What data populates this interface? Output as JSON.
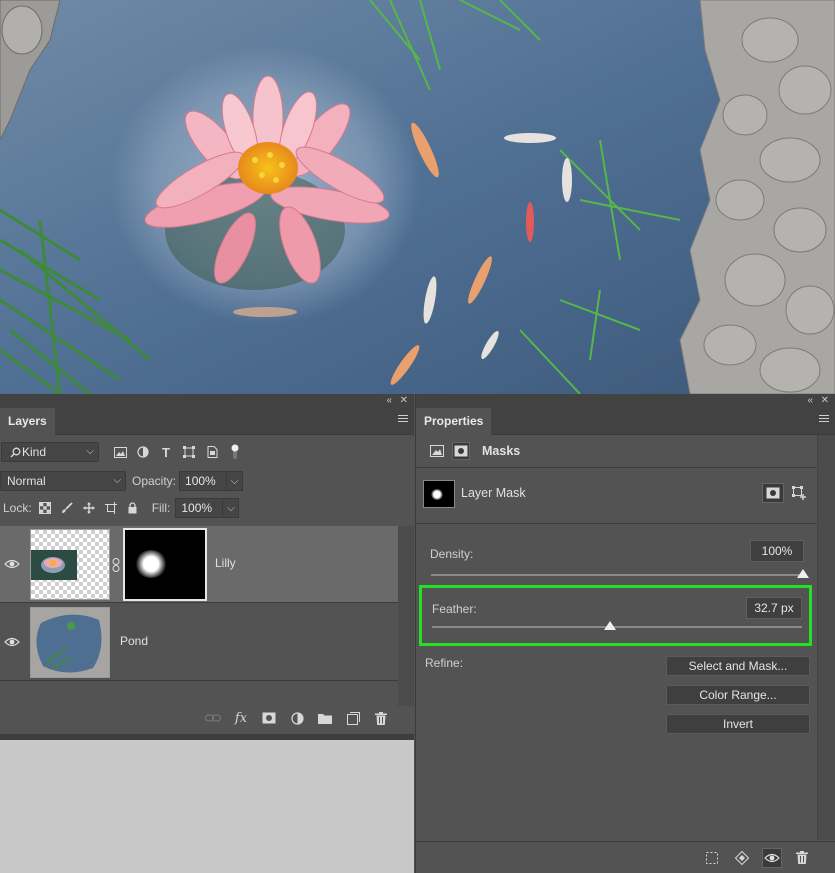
{
  "layers_panel": {
    "tab": "Layers",
    "filter": {
      "value": "Kind"
    },
    "blend_mode": "Normal",
    "opacity": {
      "label": "Opacity:",
      "value": "100%"
    },
    "lock": {
      "label": "Lock:"
    },
    "fill": {
      "label": "Fill:",
      "value": "100%"
    },
    "layers": [
      {
        "name": "Lilly",
        "selected": true
      },
      {
        "name": "Pond",
        "selected": false
      }
    ]
  },
  "properties_panel": {
    "tab": "Properties",
    "section": "Masks",
    "mask_title": "Layer Mask",
    "density": {
      "label": "Density:",
      "value": "100%",
      "level": 1.0
    },
    "feather": {
      "label": "Feather:",
      "value": "32.7 px",
      "level": 0.48
    },
    "refine_label": "Refine:",
    "buttons": [
      "Select and Mask...",
      "Color Range...",
      "Invert"
    ]
  },
  "colors": {
    "panel_bg": "#535353",
    "selected_layer": "#6a6a6a",
    "highlight": "#22e023"
  }
}
